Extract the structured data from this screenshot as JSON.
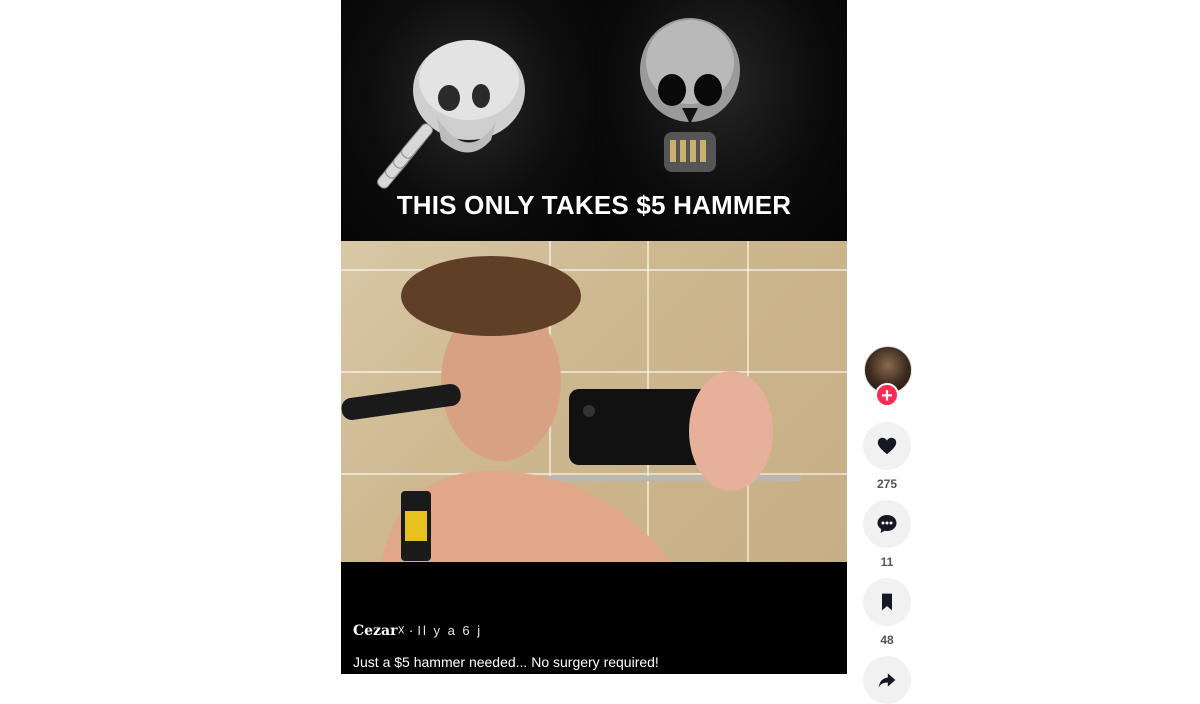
{
  "video": {
    "overlay_text": "THIS ONLY TAKES $5 HAMMER",
    "author": "Cezar",
    "author_suffix": "☓",
    "separator": "·",
    "time_ago": "Il y a 6 j",
    "description": "Just a $5 hammer needed... No surgery required!"
  },
  "actions": {
    "follow": "+",
    "likes": "275",
    "comments": "11",
    "saves": "48"
  },
  "colors": {
    "accent": "#fe2c55",
    "action_bg": "#f1f1f2"
  }
}
